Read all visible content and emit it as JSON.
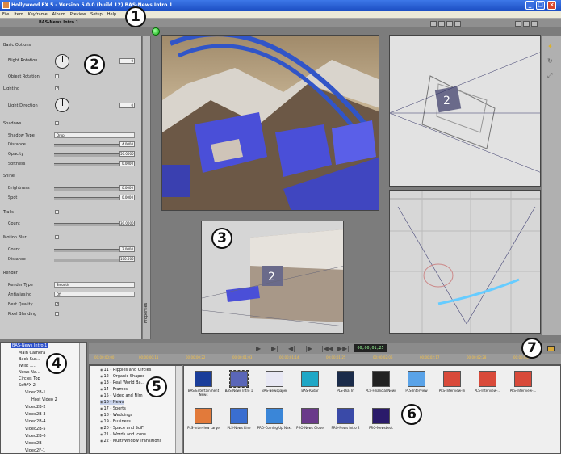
{
  "titlebar": {
    "title": "Hollywood FX 5 - Version 5.0.0 (build 12)  BAS-News Intro 1",
    "controls": [
      "_",
      "□",
      "×"
    ]
  },
  "menu": [
    "File",
    "Item",
    "Keyframe",
    "Album",
    "Preview",
    "Setup",
    "Help"
  ],
  "project_label": "BAS-News Intro 1",
  "properties": {
    "tab_label": "Properties",
    "basic_options": "Basic Options",
    "flight_rotation": "Flight Rotation",
    "flight_rotation_value": "0",
    "object_rotation": "Object Rotation",
    "lighting": "Lighting",
    "light_direction": "Light Direction",
    "light_direction_value": "0",
    "shadows": "Shadows",
    "shadow_type": "Shadow Type",
    "shadow_type_value": "Drop",
    "distance": "Distance",
    "distance_value": "4.0000",
    "opacity": "Opacity",
    "opacity_value": "50.0000",
    "softness": "Softness",
    "softness_value": "0.0000",
    "shine": "Shine",
    "brightness": "Brightness",
    "brightness_value": "0.0000",
    "spot": "Spot",
    "spot_value": "0.0000",
    "trails": "Trails",
    "trails_count": "Count",
    "trails_count_value": "30.0000",
    "motion_blur": "Motion Blur",
    "mb_count": "Count",
    "mb_count_value": "3.0000",
    "mb_distance": "Distance",
    "mb_distance_value": "100.000",
    "render": "Render",
    "render_type": "Render Type",
    "render_type_value": "Smooth",
    "antialiasing": "Antialiasing",
    "antialiasing_value": "Off",
    "best_quality": "Best Quality",
    "pixel_blending": "Pixel Blending"
  },
  "playback": {
    "timecode": "00;00;01;25",
    "ticks": [
      "00;00;00;00",
      "00;00;00;11",
      "00;00;00;22",
      "00;00;01;03",
      "00;00;01;14",
      "00;00;01;25",
      "00;00;02;06",
      "00;00;02;17",
      "00;00;02;28",
      "00;00;03;09"
    ]
  },
  "tree": {
    "items": [
      "BAS-News Intro 1",
      "Main Camera",
      "Back Sur...",
      "Twist 1...",
      "News Na...",
      "Circles Top",
      "SoftFX 2",
      "Video2B-1",
      "Host Video 2",
      "Video2B-2",
      "Video2B-3",
      "Video2B-4",
      "Video2B-5",
      "Video2B-6",
      "Video2B",
      "Video2F-1"
    ]
  },
  "categories": [
    "11 - Ripples and Circles",
    "12 - Organic Shapes",
    "13 - Real World Ba...",
    "14 - Frames",
    "15 - Video and Film",
    "16 - News",
    "17 - Sports",
    "18 - Weddings",
    "19 - Business",
    "20 - Space and SciFi",
    "21 - Words and Icons",
    "22 - MultiWindow Transitions"
  ],
  "gallery": [
    {
      "label": "BAS-Entertainment News",
      "color": "#1a3d9a"
    },
    {
      "label": "BAS-News Intro 1",
      "color": "#5a66b8"
    },
    {
      "label": "BAS-Newspaper",
      "color": "#e8e8f4"
    },
    {
      "label": "BAS-Radar",
      "color": "#1fa7c6"
    },
    {
      "label": "PLS-Dial In",
      "color": "#1b2c4a"
    },
    {
      "label": "PLS-Financial News",
      "color": "#222222"
    },
    {
      "label": "PLS-Interview",
      "color": "#5aa3e8"
    },
    {
      "label": "PLS-Interview-In",
      "color": "#d94a3a"
    },
    {
      "label": "PLS-Interview-...",
      "color": "#d94a3a"
    },
    {
      "label": "PLS-Interview-...",
      "color": "#d94a3a"
    },
    {
      "label": "PLS-Interview Large",
      "color": "#e27a3a"
    },
    {
      "label": "PLS-News Line",
      "color": "#3a6ed0"
    },
    {
      "label": "PRO-Coming Up Next",
      "color": "#3a86d8"
    },
    {
      "label": "PRO-News Globe",
      "color": "#6a3a8a"
    },
    {
      "label": "PRO-News Intro 2",
      "color": "#3a4aa8"
    },
    {
      "label": "PRO-Newsbeat",
      "color": "#2a1a6a"
    }
  ],
  "callouts": [
    "1",
    "2",
    "3",
    "4",
    "5",
    "6",
    "7"
  ]
}
